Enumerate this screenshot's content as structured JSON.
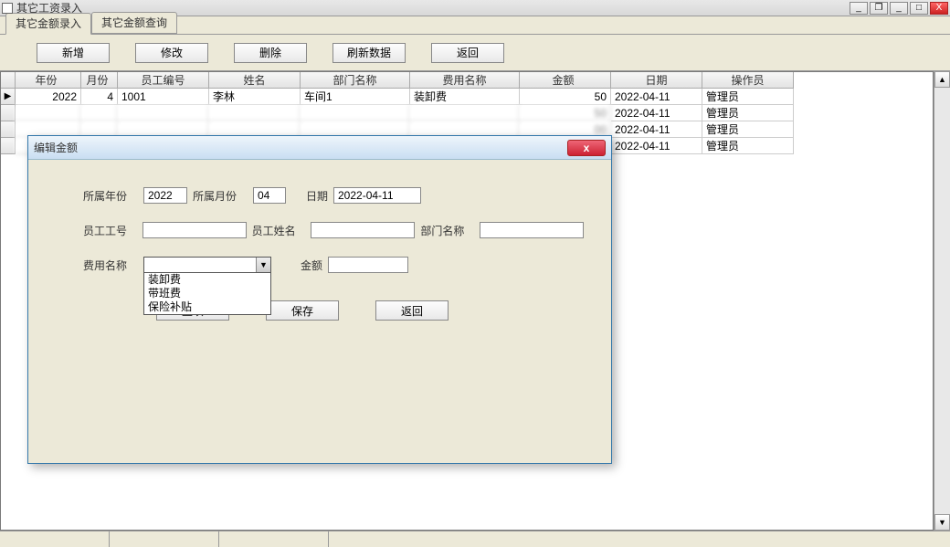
{
  "window": {
    "title": "其它工资录入"
  },
  "tabs": [
    {
      "label": "其它金额录入",
      "active": true
    },
    {
      "label": "其它金额查询",
      "active": false
    }
  ],
  "toolbar": {
    "add": "新增",
    "edit": "修改",
    "delete": "删除",
    "refresh": "刷新数据",
    "back": "返回"
  },
  "grid": {
    "columns": {
      "year": "年份",
      "month": "月份",
      "emp_no": "员工编号",
      "name": "姓名",
      "dept": "部门名称",
      "fee": "费用名称",
      "amount": "金额",
      "date": "日期",
      "operator": "操作员"
    },
    "rows": [
      {
        "year": "2022",
        "month": "4",
        "emp_no": "1001",
        "name": "李林",
        "dept": "车间1",
        "fee": "装卸费",
        "amount": "50",
        "date": "2022-04-11",
        "operator": "管理员",
        "blur": false
      },
      {
        "year": "",
        "month": "",
        "emp_no": "",
        "name": "",
        "dept": "",
        "fee": "",
        "amount": "50",
        "date": "2022-04-11",
        "operator": "管理员",
        "blur": true
      },
      {
        "year": "",
        "month": "",
        "emp_no": "",
        "name": "",
        "dept": "",
        "fee": "",
        "amount": "00",
        "date": "2022-04-11",
        "operator": "管理员",
        "blur": true
      },
      {
        "year": "",
        "month": "",
        "emp_no": "",
        "name": "",
        "dept": "",
        "fee": "",
        "amount": "00",
        "date": "2022-04-11",
        "operator": "管理员",
        "blur": true
      }
    ]
  },
  "dialog": {
    "title": "编辑金额",
    "labels": {
      "year": "所属年份",
      "month": "所属月份",
      "date": "日期",
      "emp_no": "员工工号",
      "emp_name": "员工姓名",
      "dept": "部门名称",
      "fee_name": "费用名称",
      "amount": "金额"
    },
    "values": {
      "year": "2022",
      "month": "04",
      "date": "2022-04-11",
      "emp_no": "",
      "emp_name": "",
      "dept": "",
      "fee_name": "",
      "amount": ""
    },
    "fee_options": [
      "装卸费",
      "带班费",
      "保险补贴"
    ],
    "buttons": {
      "reset": "重填",
      "save": "保存",
      "back": "返回"
    }
  }
}
